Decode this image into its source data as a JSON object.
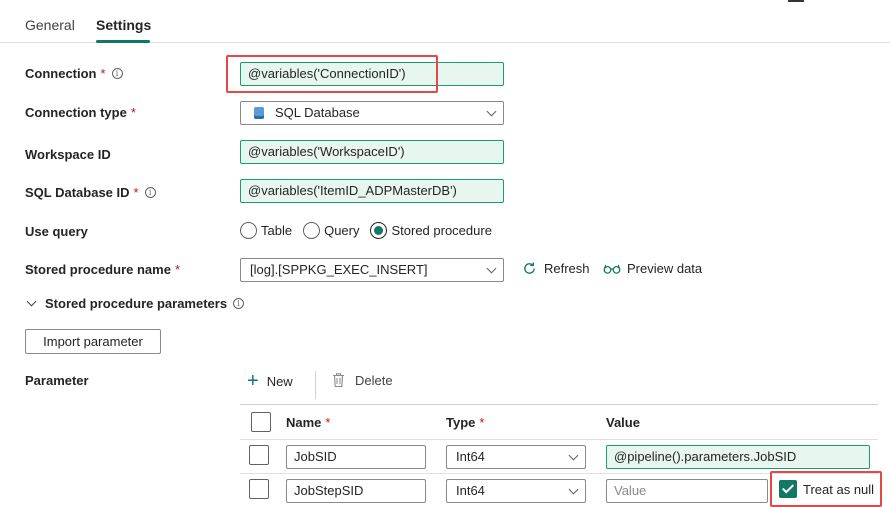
{
  "tabs": {
    "general": "General",
    "settings": "Settings"
  },
  "form": {
    "connection": {
      "label": "Connection",
      "value": "@variables('ConnectionID')"
    },
    "connection_type": {
      "label": "Connection type",
      "value": "SQL Database"
    },
    "workspace_id": {
      "label": "Workspace ID",
      "value": "@variables('WorkspaceID')"
    },
    "sql_database_id": {
      "label": "SQL Database ID",
      "value": "@variables('ItemID_ADPMasterDB')"
    },
    "use_query": {
      "label": "Use query",
      "options": [
        "Table",
        "Query",
        "Stored procedure"
      ],
      "selected": "Stored procedure"
    },
    "stored_procedure_name": {
      "label": "Stored procedure name",
      "value": "[log].[SPPKG_EXEC_INSERT]"
    },
    "refresh_label": "Refresh",
    "preview_label": "Preview data"
  },
  "required_mark": "*",
  "info_glyph": "i",
  "sp_params": {
    "section_label": "Stored procedure parameters",
    "import_label": "Import parameter",
    "parameter_label": "Parameter",
    "new_label": "New",
    "delete_label": "Delete",
    "columns": {
      "name": "Name",
      "type": "Type",
      "value": "Value"
    },
    "rows": [
      {
        "name": "JobSID",
        "type": "Int64",
        "value": "@pipeline().parameters.JobSID"
      },
      {
        "name": "JobStepSID",
        "type": "Int64",
        "value_placeholder": "Value",
        "treat_as_null": true
      }
    ],
    "treat_as_null_label": "Treat as null"
  },
  "colors": {
    "accent": "#117865",
    "expression_bg": "#e8f6f0",
    "highlight": "#e84747",
    "required": "#c50f1f"
  },
  "icons": [
    "database-icon",
    "refresh-icon",
    "glasses-icon",
    "plus-icon",
    "trash-icon",
    "info-icon",
    "chevron-down-icon",
    "checkmark-icon"
  ]
}
